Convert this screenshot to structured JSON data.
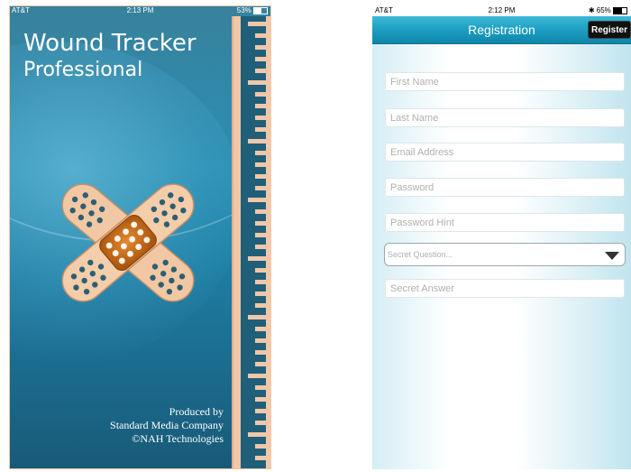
{
  "splash": {
    "status_bar": {
      "carrier": "AT&T",
      "time": "2:13 PM",
      "battery": "53%"
    },
    "title_line1": "Wound Tracker",
    "title_line2": "Professional",
    "credits": [
      "Produced by",
      "Standard Media Company",
      "©NAH Technologies"
    ],
    "icons": {
      "logo": "crossed-bandages-icon"
    },
    "colors": {
      "background": "#2a8fb3",
      "ruler": "#f0c7a8",
      "text": "#ffffff"
    }
  },
  "registration": {
    "status_bar": {
      "carrier": "AT&T",
      "time": "2:12 PM",
      "battery": "65%"
    },
    "nav_title": "Registration",
    "register_button": "Register",
    "fields": {
      "first_name": "First Name",
      "last_name": "Last Name",
      "email": "Email Address",
      "password": "Password",
      "password_hint": "Password Hint",
      "secret_question": "Secret Question...",
      "secret_answer": "Secret Answer"
    },
    "colors": {
      "nav_bar": "#1a9cc0",
      "button": "#111111"
    }
  }
}
